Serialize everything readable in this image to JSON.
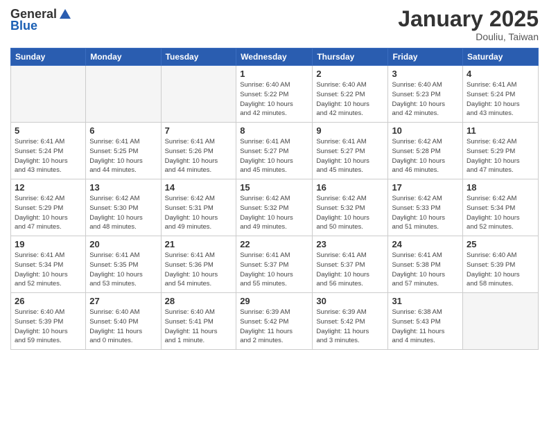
{
  "header": {
    "logo_general": "General",
    "logo_blue": "Blue",
    "month_title": "January 2025",
    "location": "Douliu, Taiwan"
  },
  "weekdays": [
    "Sunday",
    "Monday",
    "Tuesday",
    "Wednesday",
    "Thursday",
    "Friday",
    "Saturday"
  ],
  "weeks": [
    [
      {
        "day": "",
        "info": ""
      },
      {
        "day": "",
        "info": ""
      },
      {
        "day": "",
        "info": ""
      },
      {
        "day": "1",
        "info": "Sunrise: 6:40 AM\nSunset: 5:22 PM\nDaylight: 10 hours\nand 42 minutes."
      },
      {
        "day": "2",
        "info": "Sunrise: 6:40 AM\nSunset: 5:22 PM\nDaylight: 10 hours\nand 42 minutes."
      },
      {
        "day": "3",
        "info": "Sunrise: 6:40 AM\nSunset: 5:23 PM\nDaylight: 10 hours\nand 42 minutes."
      },
      {
        "day": "4",
        "info": "Sunrise: 6:41 AM\nSunset: 5:24 PM\nDaylight: 10 hours\nand 43 minutes."
      }
    ],
    [
      {
        "day": "5",
        "info": "Sunrise: 6:41 AM\nSunset: 5:24 PM\nDaylight: 10 hours\nand 43 minutes."
      },
      {
        "day": "6",
        "info": "Sunrise: 6:41 AM\nSunset: 5:25 PM\nDaylight: 10 hours\nand 44 minutes."
      },
      {
        "day": "7",
        "info": "Sunrise: 6:41 AM\nSunset: 5:26 PM\nDaylight: 10 hours\nand 44 minutes."
      },
      {
        "day": "8",
        "info": "Sunrise: 6:41 AM\nSunset: 5:27 PM\nDaylight: 10 hours\nand 45 minutes."
      },
      {
        "day": "9",
        "info": "Sunrise: 6:41 AM\nSunset: 5:27 PM\nDaylight: 10 hours\nand 45 minutes."
      },
      {
        "day": "10",
        "info": "Sunrise: 6:42 AM\nSunset: 5:28 PM\nDaylight: 10 hours\nand 46 minutes."
      },
      {
        "day": "11",
        "info": "Sunrise: 6:42 AM\nSunset: 5:29 PM\nDaylight: 10 hours\nand 47 minutes."
      }
    ],
    [
      {
        "day": "12",
        "info": "Sunrise: 6:42 AM\nSunset: 5:29 PM\nDaylight: 10 hours\nand 47 minutes."
      },
      {
        "day": "13",
        "info": "Sunrise: 6:42 AM\nSunset: 5:30 PM\nDaylight: 10 hours\nand 48 minutes."
      },
      {
        "day": "14",
        "info": "Sunrise: 6:42 AM\nSunset: 5:31 PM\nDaylight: 10 hours\nand 49 minutes."
      },
      {
        "day": "15",
        "info": "Sunrise: 6:42 AM\nSunset: 5:32 PM\nDaylight: 10 hours\nand 49 minutes."
      },
      {
        "day": "16",
        "info": "Sunrise: 6:42 AM\nSunset: 5:32 PM\nDaylight: 10 hours\nand 50 minutes."
      },
      {
        "day": "17",
        "info": "Sunrise: 6:42 AM\nSunset: 5:33 PM\nDaylight: 10 hours\nand 51 minutes."
      },
      {
        "day": "18",
        "info": "Sunrise: 6:42 AM\nSunset: 5:34 PM\nDaylight: 10 hours\nand 52 minutes."
      }
    ],
    [
      {
        "day": "19",
        "info": "Sunrise: 6:41 AM\nSunset: 5:34 PM\nDaylight: 10 hours\nand 52 minutes."
      },
      {
        "day": "20",
        "info": "Sunrise: 6:41 AM\nSunset: 5:35 PM\nDaylight: 10 hours\nand 53 minutes."
      },
      {
        "day": "21",
        "info": "Sunrise: 6:41 AM\nSunset: 5:36 PM\nDaylight: 10 hours\nand 54 minutes."
      },
      {
        "day": "22",
        "info": "Sunrise: 6:41 AM\nSunset: 5:37 PM\nDaylight: 10 hours\nand 55 minutes."
      },
      {
        "day": "23",
        "info": "Sunrise: 6:41 AM\nSunset: 5:37 PM\nDaylight: 10 hours\nand 56 minutes."
      },
      {
        "day": "24",
        "info": "Sunrise: 6:41 AM\nSunset: 5:38 PM\nDaylight: 10 hours\nand 57 minutes."
      },
      {
        "day": "25",
        "info": "Sunrise: 6:40 AM\nSunset: 5:39 PM\nDaylight: 10 hours\nand 58 minutes."
      }
    ],
    [
      {
        "day": "26",
        "info": "Sunrise: 6:40 AM\nSunset: 5:39 PM\nDaylight: 10 hours\nand 59 minutes."
      },
      {
        "day": "27",
        "info": "Sunrise: 6:40 AM\nSunset: 5:40 PM\nDaylight: 11 hours\nand 0 minutes."
      },
      {
        "day": "28",
        "info": "Sunrise: 6:40 AM\nSunset: 5:41 PM\nDaylight: 11 hours\nand 1 minute."
      },
      {
        "day": "29",
        "info": "Sunrise: 6:39 AM\nSunset: 5:42 PM\nDaylight: 11 hours\nand 2 minutes."
      },
      {
        "day": "30",
        "info": "Sunrise: 6:39 AM\nSunset: 5:42 PM\nDaylight: 11 hours\nand 3 minutes."
      },
      {
        "day": "31",
        "info": "Sunrise: 6:38 AM\nSunset: 5:43 PM\nDaylight: 11 hours\nand 4 minutes."
      },
      {
        "day": "",
        "info": ""
      }
    ]
  ]
}
